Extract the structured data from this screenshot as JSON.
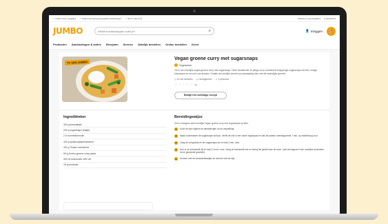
{
  "topbar": {
    "usps": [
      "Gratis retour, dagelijks",
      "Gratis bezorging bij bepaalde aanbiedingen",
      "Vers in aan huis"
    ],
    "utils": [
      "Winkels & openingstijden",
      "Nederland"
    ]
  },
  "header": {
    "logo": "JUMBO",
    "search_placeholder": "Welke boodschappen zoek je?",
    "login_label": "Inloggen"
  },
  "nav": {
    "items": [
      "Producten",
      "Aanbiedingen & acties",
      "Recepten",
      "Service",
      "Zakelijk bestellen",
      "Online bestellen",
      "Kerst"
    ]
  },
  "recipe": {
    "badge": "TV VAN JUMBO",
    "title": "Vegan groene curry met sugarsnaps",
    "tag": "Vegetarisch",
    "description": "Zin in een heerlijke vegan groene curry met sugarsnaps. Deze smaakvolle en pittige curry combineert knapperige sugarsnaps met een romige kokossaus en een mix van kruiden. Ontdek de heerlijke wereld van plantaardig eten met dit smakelijke gerecht.",
    "meta": [
      "20 min bereiden",
      "Hoofdgerecht",
      "4 personen"
    ],
    "rating_count": "(0)",
    "full_recipe_button": "Bekijk het volledige recept"
  },
  "ingredients": {
    "title": "Ingrediënten",
    "items": [
      "300 g basmatirijst",
      "200 g sugarsnaps (bakje)",
      "2 el zonnebloemolie",
      "400 g spitskoolpaprika/bloem",
      "400 g Thaise roerbakmix",
      "65 g Jumbo groene curry pasta",
      "400 ml kokosmelk 18% vet",
      "15 g koriander"
    ]
  },
  "method": {
    "title": "Bereidingswijze",
    "intro": "Zet in 6 stappen deze heerlijke vegan groene curry met sugarsnaps op tafel.",
    "steps": [
      "Kook de rijst volgens de aanwijzingen op de verpakking.",
      "Maak ondertussen de sugarsnaps schoon. Verhit de olie in een ruime hapjespan en bak de paarse roerbakgroente 7 min. op middelhoog vuur.",
      "Voeg de currypasta en de sugarsnaps toe en bak 3 min. mee.",
      "Doe er de kokosmelk bij en laat 3–5 min. mee. Voeg de kokosmelk toe en breng het geheel aan de kook. Laat vervolgens 5 min. zachtjes doorkoken tot de gewenste gaarheid.",
      "Serveer met de koriandeblaadjes en serveer met de rijst."
    ]
  }
}
